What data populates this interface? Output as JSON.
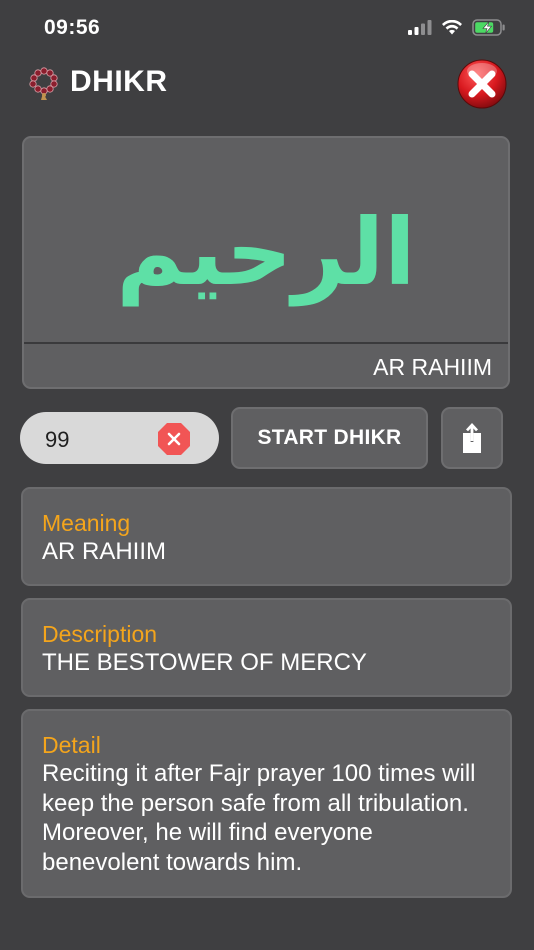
{
  "status": {
    "time": "09:56"
  },
  "header": {
    "title": "DHIKR"
  },
  "name": {
    "arabic": "الرحيم",
    "transliteration": "AR RAHIIM"
  },
  "controls": {
    "count": "99",
    "start_label": "START DHIKR"
  },
  "info": {
    "meaning_label": "Meaning",
    "meaning": "AR RAHIIM",
    "description_label": "Description",
    "description": "THE BESTOWER OF MERCY",
    "detail_label": "Detail",
    "detail": "Reciting it after Fajr prayer 100 times will keep the person safe from all tribulation. Moreover, he will find everyone benevolent towards him."
  },
  "colors": {
    "background": "#3f3f41",
    "card": "#5f5f61",
    "arabic_text": "#5ee0a6",
    "label_accent": "#f4a51c",
    "close_red": "#d8191f",
    "battery_green": "#4cd964"
  },
  "icons": {
    "app_logo": "prayer-beads-icon",
    "close": "close-icon",
    "clear": "clear-icon",
    "share": "share-icon",
    "signal": "signal-icon",
    "wifi": "wifi-icon",
    "battery": "battery-charging-icon"
  }
}
